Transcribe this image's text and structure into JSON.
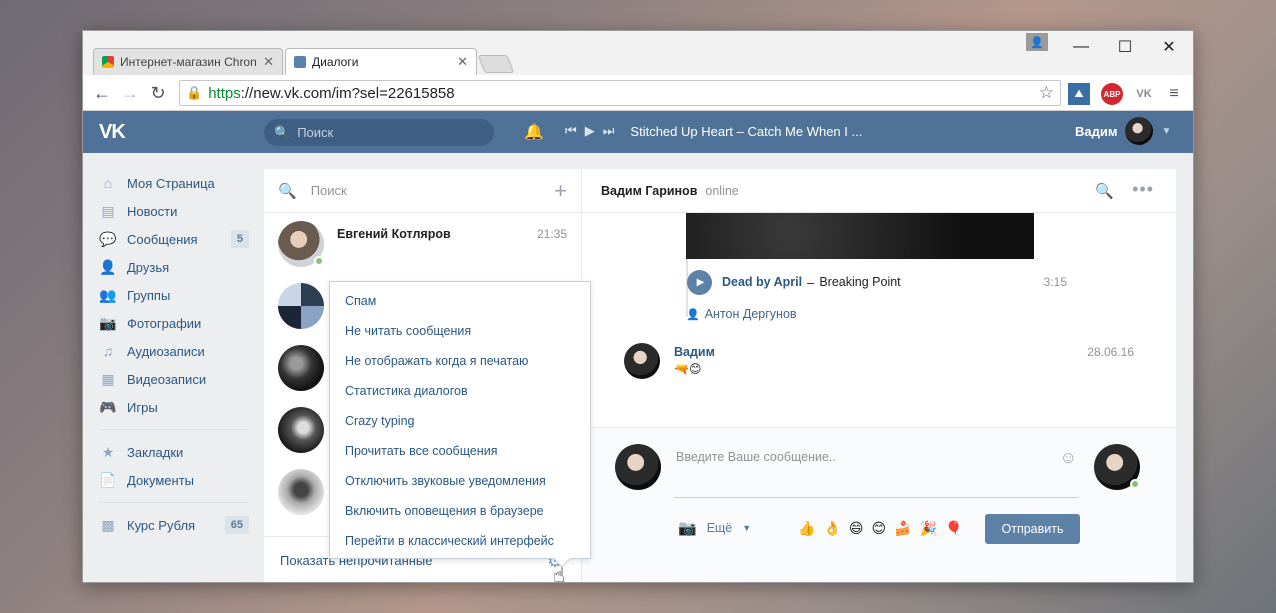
{
  "browser": {
    "tabs": [
      {
        "label": "Интернет-магазин Chron",
        "active": false
      },
      {
        "label": "Диалоги",
        "active": true
      }
    ],
    "url": {
      "scheme": "https",
      "rest": "://new.vk.com/im?sel=22615858"
    },
    "extensions": [
      "abp-icon",
      "vk-icon"
    ]
  },
  "vk": {
    "search_placeholder": "Поиск",
    "now_playing": "Stitched Up Heart – Catch Me When I ...",
    "user_name": "Вадим"
  },
  "menu": [
    {
      "label": "Моя Страница",
      "icon": "home-icon"
    },
    {
      "label": "Новости",
      "icon": "news-icon"
    },
    {
      "label": "Сообщения",
      "icon": "messages-icon",
      "badge": "5"
    },
    {
      "label": "Друзья",
      "icon": "friends-icon"
    },
    {
      "label": "Группы",
      "icon": "groups-icon"
    },
    {
      "label": "Фотографии",
      "icon": "photo-icon"
    },
    {
      "label": "Аудиозаписи",
      "icon": "music-icon"
    },
    {
      "label": "Видеозаписи",
      "icon": "video-icon"
    },
    {
      "label": "Игры",
      "icon": "games-icon"
    },
    {
      "label": "Закладки",
      "icon": "star-icon"
    },
    {
      "label": "Документы",
      "icon": "document-icon"
    },
    {
      "label": "Курс Рубля",
      "icon": "app-icon",
      "badge": "65"
    }
  ],
  "dialogs": {
    "search_placeholder": "Поиск",
    "first": {
      "name": "Евгений Котляров",
      "time": "21:35"
    },
    "footer_link": "Показать непрочитанные"
  },
  "dropdown": [
    "Спам",
    "Не читать сообщения",
    "Не отображать когда я печатаю",
    "Статистика диалогов",
    "Crazy typing",
    "Прочитать все сообщения",
    "Отключить звуковые уведомления",
    "Включить оповещения в браузере",
    "Перейти в классический интерфейс"
  ],
  "chat": {
    "partner": "Вадим Гаринов",
    "status": "online",
    "audio": {
      "artist": "Dead by April",
      "dash": "–",
      "title": "Breaking Point",
      "duration": "3:15"
    },
    "forwarded_from": "Антон Дергунов",
    "message": {
      "author": "Вадим",
      "date": "28.06.16",
      "emoji": "🔫😊"
    },
    "input_placeholder": "Введите Ваше сообщение..",
    "more_label": "Ещё",
    "emojis": [
      "👍",
      "👌",
      "😄",
      "😊",
      "🍰",
      "🎉",
      "🎈"
    ],
    "send_label": "Отправить"
  }
}
